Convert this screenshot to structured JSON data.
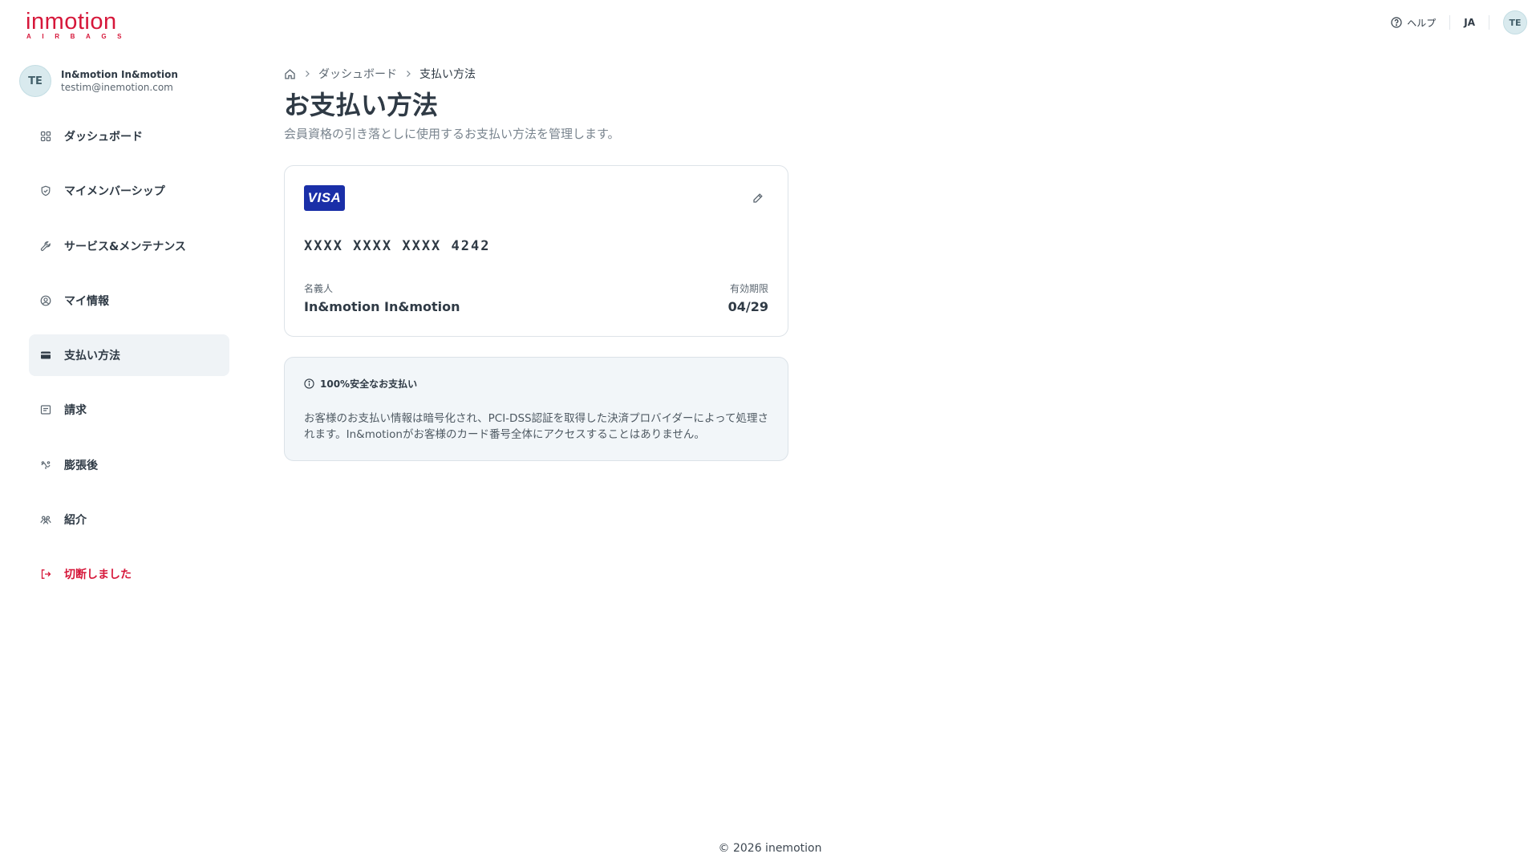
{
  "brand": {
    "name": "inmotion",
    "tagline": "AIRBAGS",
    "color": "#d6173a"
  },
  "header": {
    "help_label": "ヘルプ",
    "lang": "JA",
    "avatar_initials": "TE"
  },
  "user": {
    "initials": "TE",
    "name": "In&motion In&motion",
    "email": "testim@inemotion.com"
  },
  "sidebar": {
    "items": [
      {
        "label": "ダッシュボード",
        "icon": "grid-icon"
      },
      {
        "label": "マイメンバーシップ",
        "icon": "shield-icon"
      },
      {
        "label": "サービス&メンテナンス",
        "icon": "wrench-icon"
      },
      {
        "label": "マイ情報",
        "icon": "user-circle-icon"
      },
      {
        "label": "支払い方法",
        "icon": "credit-card-icon",
        "active": true
      },
      {
        "label": "請求",
        "icon": "receipt-icon"
      },
      {
        "label": "膨張後",
        "icon": "inflation-icon"
      },
      {
        "label": "紹介",
        "icon": "users-icon"
      }
    ],
    "logout_label": "切断しました"
  },
  "breadcrumb": {
    "level1": "ダッシュボード",
    "current": "支払い方法"
  },
  "page": {
    "title": "お支払い方法",
    "subtitle": "会員資格の引き落としに使用するお支払い方法を管理します。"
  },
  "card": {
    "brand": "VISA",
    "number": "XXXX XXXX XXXX 4242",
    "holder_label": "名義人",
    "holder_name": "In&motion In&motion",
    "expiry_label": "有効期限",
    "expiry": "04/29"
  },
  "security": {
    "title": "100%安全なお支払い",
    "text": "お客様のお支払い情報は暗号化され、PCI-DSS認証を取得した決済プロバイダーによって処理されます。In&motionがお客様のカード番号全体にアクセスすることはありません。"
  },
  "footer": {
    "copyright": "© 2026 inemotion"
  }
}
